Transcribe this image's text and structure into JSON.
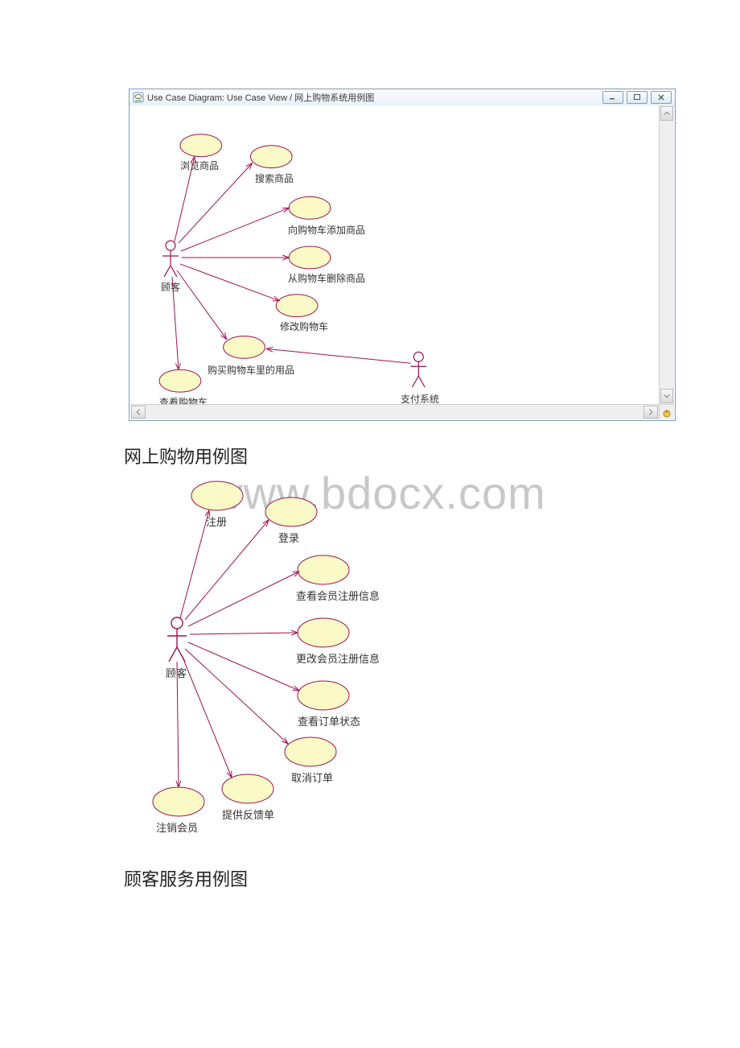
{
  "window": {
    "title": "Use Case Diagram: Use Case View / 网上购物系统用例图"
  },
  "captions": {
    "shopping": "网上购物用例图",
    "service": "顾客服务用例图"
  },
  "watermark": "www.bdocx.com",
  "diagram1": {
    "actors": {
      "customer": "顾客",
      "payment": "支付系统"
    },
    "usecases": {
      "browse": "浏览商品",
      "search": "搜索商品",
      "addCart": "向购物车添加商品",
      "removeCart": "从购物车删除商品",
      "modifyCart": "修改购物车",
      "purchase": "购买购物车里的用品",
      "viewCart": "查看购物车"
    }
  },
  "diagram2": {
    "actor": "顾客",
    "usecases": {
      "register": "注册",
      "login": "登录",
      "viewMember": "查看会员注册信息",
      "editMember": "更改会员注册信息",
      "orderStatus": "查看订单状态",
      "cancelOrder": "取消订单",
      "feedback": "提供反馈单",
      "unregister": "注销会员"
    }
  }
}
